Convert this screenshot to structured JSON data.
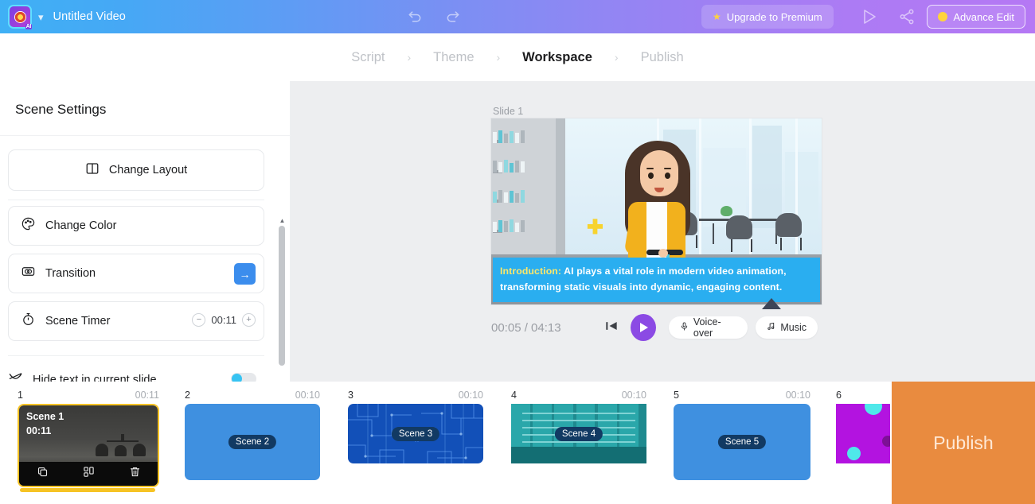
{
  "header": {
    "logo_icon": "ai-video-logo-icon",
    "caret_icon": "chevron-down-icon",
    "document_title": "Untitled Video",
    "undo_icon": "undo-icon",
    "redo_icon": "redo-icon",
    "upgrade_label": "Upgrade to Premium",
    "upgrade_star_icon": "star-icon",
    "preview_play_icon": "play-outline-icon",
    "share_icon": "share-icon",
    "advance_edit_label": "Advance Edit",
    "advance_edit_icon": "crown-icon",
    "gradient_start": "#3fb0f5",
    "gradient_end": "#b578f4"
  },
  "breadcrumb": {
    "steps": [
      {
        "label": "Script",
        "active": false
      },
      {
        "label": "Theme",
        "active": false
      },
      {
        "label": "Workspace",
        "active": true
      },
      {
        "label": "Publish",
        "active": false
      }
    ],
    "separator": "›"
  },
  "sidebar": {
    "title": "Scene Settings",
    "items": [
      {
        "label": "Change Layout",
        "icon": "layout-columns-icon"
      },
      {
        "label": "Change Color",
        "icon": "palette-icon"
      },
      {
        "label": "Transition",
        "icon": "transition-icon",
        "action_icon": "arrow-right-icon"
      },
      {
        "label": "Scene Timer",
        "icon": "stopwatch-icon",
        "value": "00:11",
        "minus": "−",
        "plus": "+"
      },
      {
        "label": "Hide text in current slide",
        "icon": "eye-off-icon",
        "toggle_on": true
      }
    ],
    "scroll_up_icon": "caret-up-icon",
    "scroll_down_icon": "caret-down-icon"
  },
  "preview": {
    "slide_label": "Slide 1",
    "caption_lead": "Introduction:",
    "caption_body": " AI plays a vital role in modern video animation, transforming static visuals into dynamic, engaging content.",
    "sparkle_icon": "sparkle-plus-icon",
    "marker_icon": "triangle-marker-icon",
    "playback": {
      "current_time": "00:05",
      "separator": "/",
      "total_time": "04:13",
      "time_display": "00:05 / 04:13",
      "prev_icon": "skip-previous-icon",
      "play_icon": "play-icon",
      "voiceover_label": "Voice-over",
      "voiceover_icon": "microphone-icon",
      "music_label": "Music",
      "music_icon": "music-note-icon",
      "play_button_color": "#8b4ae4"
    }
  },
  "timeline": {
    "scenes": [
      {
        "num": "1",
        "duration": "00:11",
        "title": "Scene 1",
        "inner_time": "00:11",
        "selected": true,
        "actions": [
          {
            "icon": "copy-icon",
            "name": "duplicate-scene-button"
          },
          {
            "icon": "layout-icon",
            "name": "change-layout-button"
          },
          {
            "icon": "trash-icon",
            "name": "delete-scene-button"
          }
        ]
      },
      {
        "num": "2",
        "duration": "00:10",
        "badge": "Scene 2",
        "selected": false
      },
      {
        "num": "3",
        "duration": "00:10",
        "badge": "Scene 3",
        "selected": false
      },
      {
        "num": "4",
        "duration": "00:10",
        "badge": "Scene 4",
        "selected": false
      },
      {
        "num": "5",
        "duration": "00:10",
        "badge": "Scene 5",
        "selected": false
      },
      {
        "num": "6",
        "duration": "",
        "badge": "",
        "selected": false
      }
    ],
    "publish_label": "Publish",
    "publish_color": "#e98b3f",
    "selection_color": "#f6c324"
  }
}
